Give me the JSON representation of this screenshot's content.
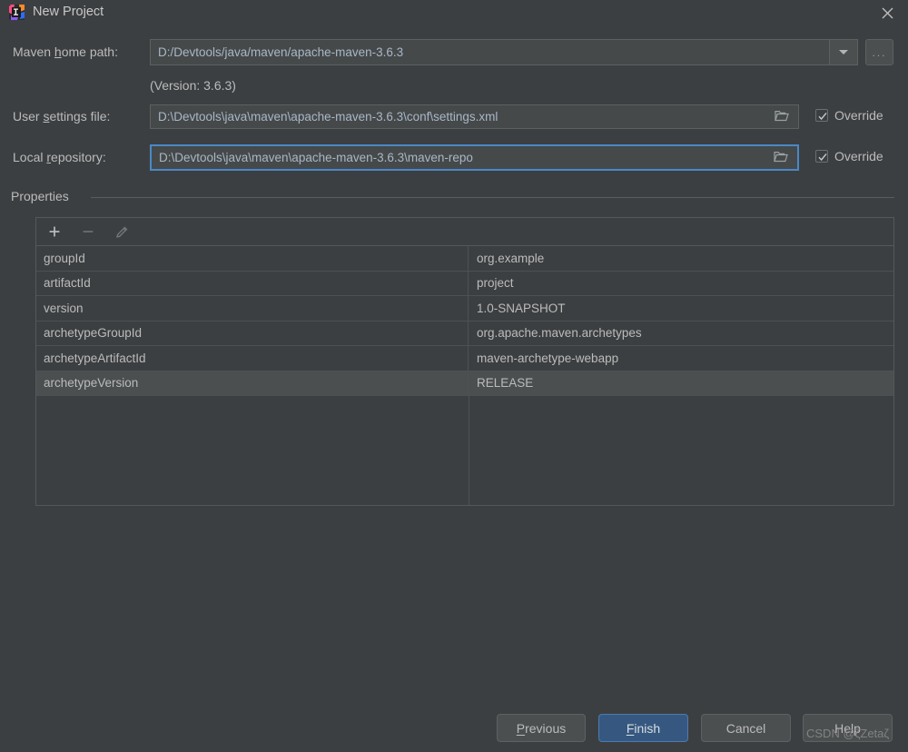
{
  "window": {
    "title": "New Project",
    "icon": "intellij-idea-icon",
    "close_icon": "close-icon",
    "background_color": "#3c3f41"
  },
  "form": {
    "maven_home": {
      "label_prefix": "Maven ",
      "label_mnemonic": "h",
      "label_suffix": "ome path:",
      "label_full": "Maven home path:",
      "value": "D:/Devtools/java/maven/apache-maven-3.6.3",
      "dropdown_icon": "chevron-down-icon",
      "browse_label": "..."
    },
    "version_note": "(Version: 3.6.3)",
    "user_settings": {
      "label_prefix": "User ",
      "label_mnemonic": "s",
      "label_suffix": "ettings file:",
      "label_full": "User settings file:",
      "value": "D:\\Devtools\\java\\maven\\apache-maven-3.6.3\\conf\\settings.xml",
      "browse_icon": "folder-icon",
      "override_label": "Override",
      "override_checked": true
    },
    "local_repository": {
      "label_prefix": "Local ",
      "label_mnemonic": "r",
      "label_suffix": "epository:",
      "label_full": "Local repository:",
      "value": "D:\\Devtools\\java\\maven\\apache-maven-3.6.3\\maven-repo",
      "browse_icon": "folder-icon",
      "override_label": "Override",
      "override_checked": true,
      "focused": true
    }
  },
  "properties": {
    "group_label": "Properties",
    "toolbar": {
      "add_icon": "plus-icon",
      "remove_icon": "minus-icon",
      "edit_icon": "pencil-icon"
    },
    "rows": [
      {
        "key": "groupId",
        "value": "org.example",
        "selected": false
      },
      {
        "key": "artifactId",
        "value": "project",
        "selected": false
      },
      {
        "key": "version",
        "value": "1.0-SNAPSHOT",
        "selected": false
      },
      {
        "key": "archetypeGroupId",
        "value": "org.apache.maven.archetypes",
        "selected": false
      },
      {
        "key": "archetypeArtifactId",
        "value": "maven-archetype-webapp",
        "selected": false
      },
      {
        "key": "archetypeVersion",
        "value": "RELEASE",
        "selected": true
      }
    ]
  },
  "buttons": {
    "previous": {
      "prefix": "",
      "mnemonic": "P",
      "suffix": "revious",
      "full": "Previous"
    },
    "finish": {
      "prefix": "",
      "mnemonic": "F",
      "suffix": "inish",
      "full": "Finish",
      "primary": true,
      "accent_color": "#365880"
    },
    "cancel": {
      "full": "Cancel"
    },
    "help": {
      "full": "Help"
    }
  },
  "watermark": "CSDN @ζZetaζ"
}
